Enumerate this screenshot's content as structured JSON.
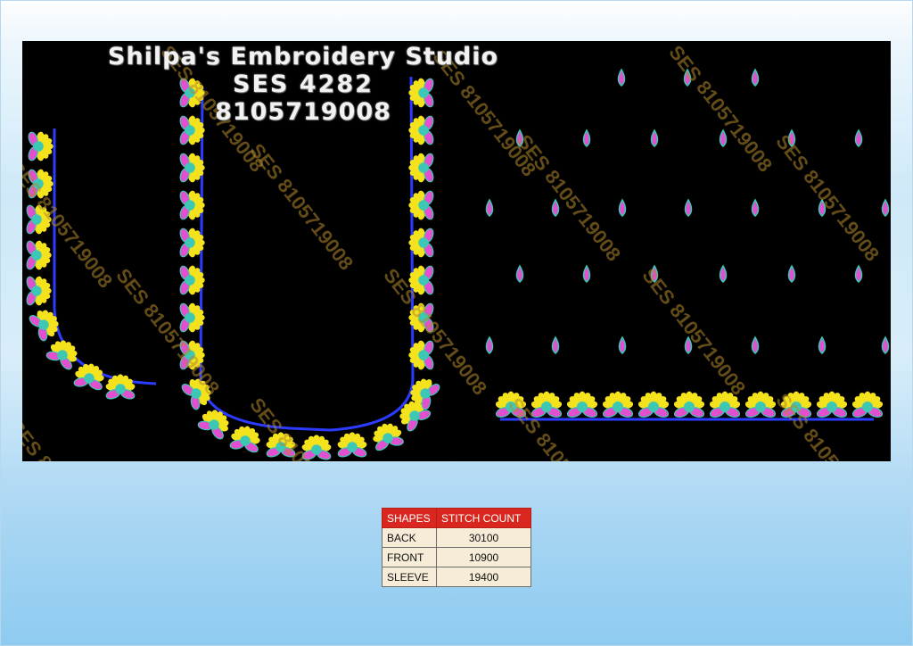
{
  "header": {
    "studio_name": "Shilpa's Embroidery Studio",
    "design_code": "SES 4282",
    "phone": "8105719008"
  },
  "watermark_text": "SES 8105719008",
  "colors": {
    "background": "#000000",
    "outline": "#2b3bff",
    "petal_yellow": "#f4e21c",
    "leaf_pink": "#e24fcf",
    "center_teal": "#3cc8b4",
    "table_header": "#d9271f"
  },
  "table": {
    "headers": [
      "SHAPES",
      "STITCH COUNT"
    ],
    "rows": [
      {
        "shape": "BACK",
        "count": "30100"
      },
      {
        "shape": "FRONT",
        "count": "10900"
      },
      {
        "shape": "SLEEVE",
        "count": "19400"
      }
    ]
  }
}
